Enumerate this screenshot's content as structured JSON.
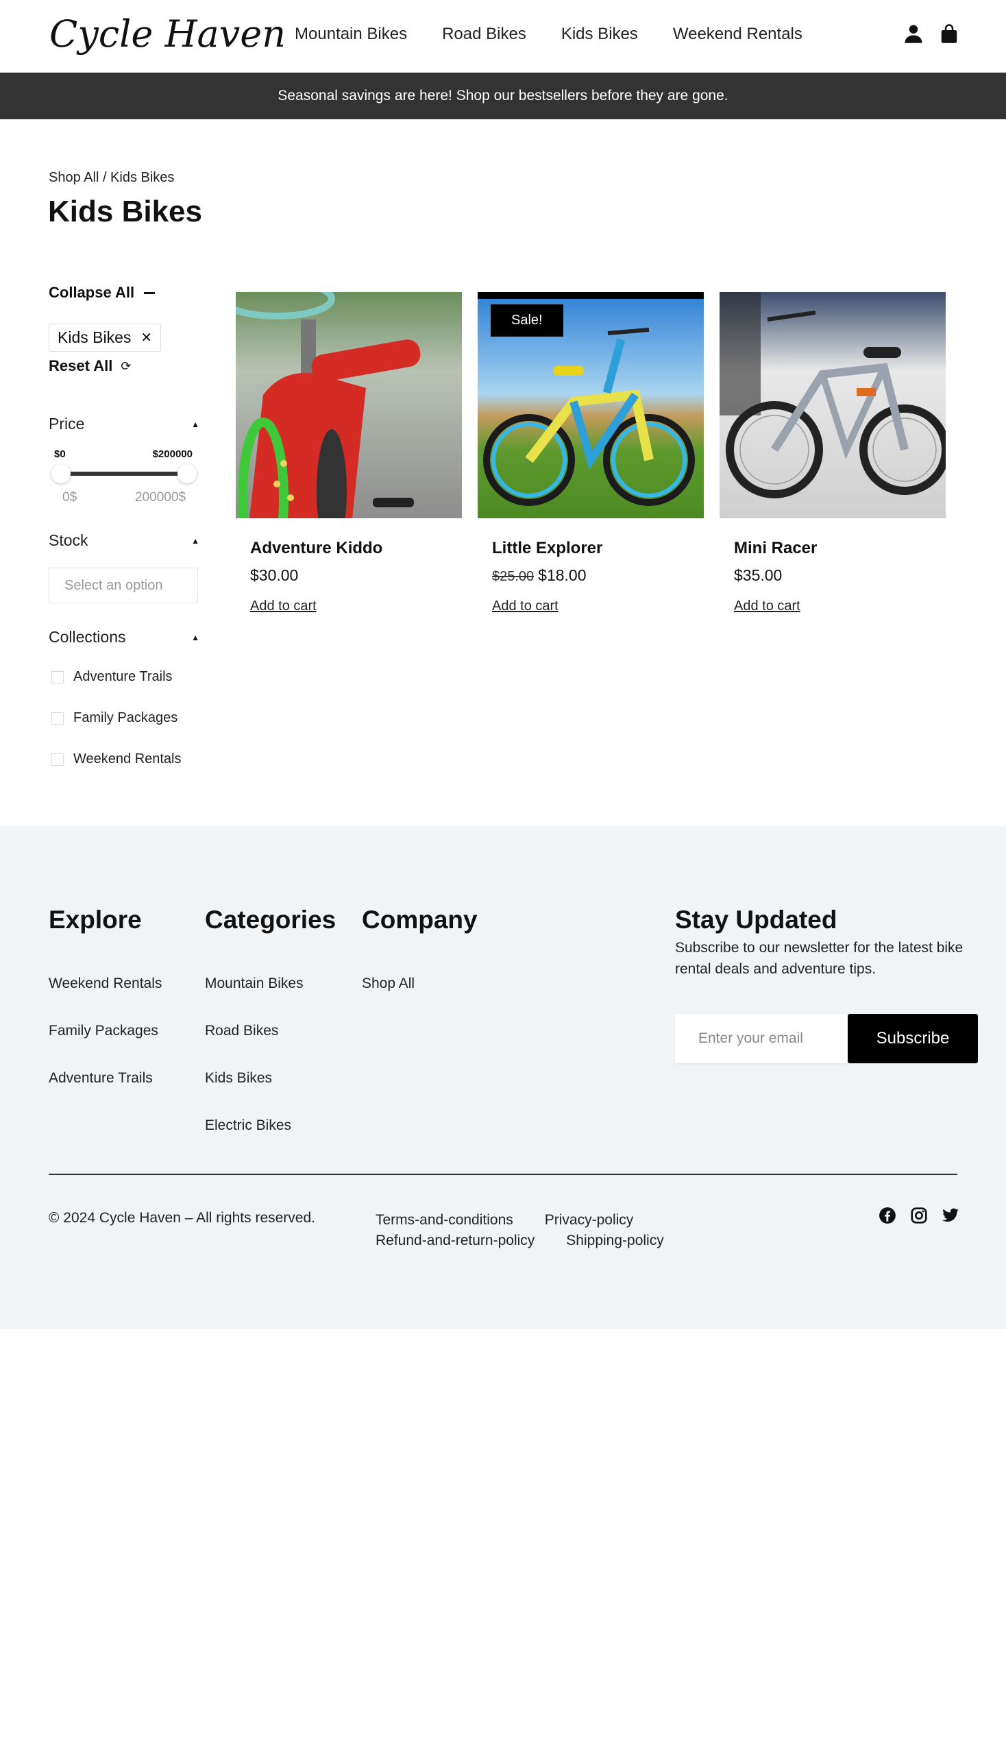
{
  "header": {
    "logo": "Cycle Haven",
    "nav": [
      "Mountain Bikes",
      "Road Bikes",
      "Kids Bikes",
      "Weekend Rentals"
    ],
    "icons": [
      "user-icon",
      "shopping-bag-icon"
    ]
  },
  "announcement": "Seasonal savings are here! Shop our bestsellers before they are gone.",
  "breadcrumb": "Shop All / Kids Bikes",
  "page_title": "Kids Bikes",
  "sidebar": {
    "collapse_all": "Collapse All",
    "active_filter": "Kids Bikes",
    "reset_all": "Reset All",
    "price": {
      "heading": "Price",
      "min_label": "$0",
      "max_label": "$200000",
      "min_value": "0$",
      "max_value": "200000$"
    },
    "stock": {
      "heading": "Stock",
      "placeholder": "Select an option"
    },
    "collections": {
      "heading": "Collections",
      "options": [
        "Adventure Trails",
        "Family Packages",
        "Weekend Rentals"
      ]
    }
  },
  "products": [
    {
      "name": "Adventure Kiddo",
      "price": "$30.00",
      "old_price": "",
      "badge": "",
      "cta": "Add to cart"
    },
    {
      "name": "Little Explorer",
      "price": "$18.00",
      "old_price": "$25.00",
      "badge": "Sale!",
      "cta": "Add to cart"
    },
    {
      "name": "Mini Racer",
      "price": "$35.00",
      "old_price": "",
      "badge": "",
      "cta": "Add to cart"
    }
  ],
  "footer": {
    "explore": {
      "heading": "Explore",
      "links": [
        "Weekend Rentals",
        "Family Packages",
        "Adventure Trails"
      ]
    },
    "categories": {
      "heading": "Categories",
      "links": [
        "Mountain Bikes",
        "Road Bikes",
        "Kids Bikes",
        "Electric Bikes"
      ]
    },
    "company": {
      "heading": "Company",
      "links": [
        "Shop All"
      ]
    },
    "newsletter": {
      "heading": "Stay Updated",
      "text": "Subscribe to our newsletter for the latest bike rental deals and adventure tips.",
      "placeholder": "Enter your email",
      "button": "Subscribe"
    },
    "copyright": "© 2024 Cycle Haven – All rights reserved.",
    "legal": [
      "Terms-and-conditions",
      "Privacy-policy",
      "Refund-and-return-policy",
      "Shipping-policy"
    ],
    "social": [
      "facebook-icon",
      "instagram-icon",
      "twitter-icon"
    ]
  },
  "colors": {
    "announcement_bg": "#333333",
    "footer_bg": "#f2f3f5",
    "button_bg": "#000000"
  }
}
